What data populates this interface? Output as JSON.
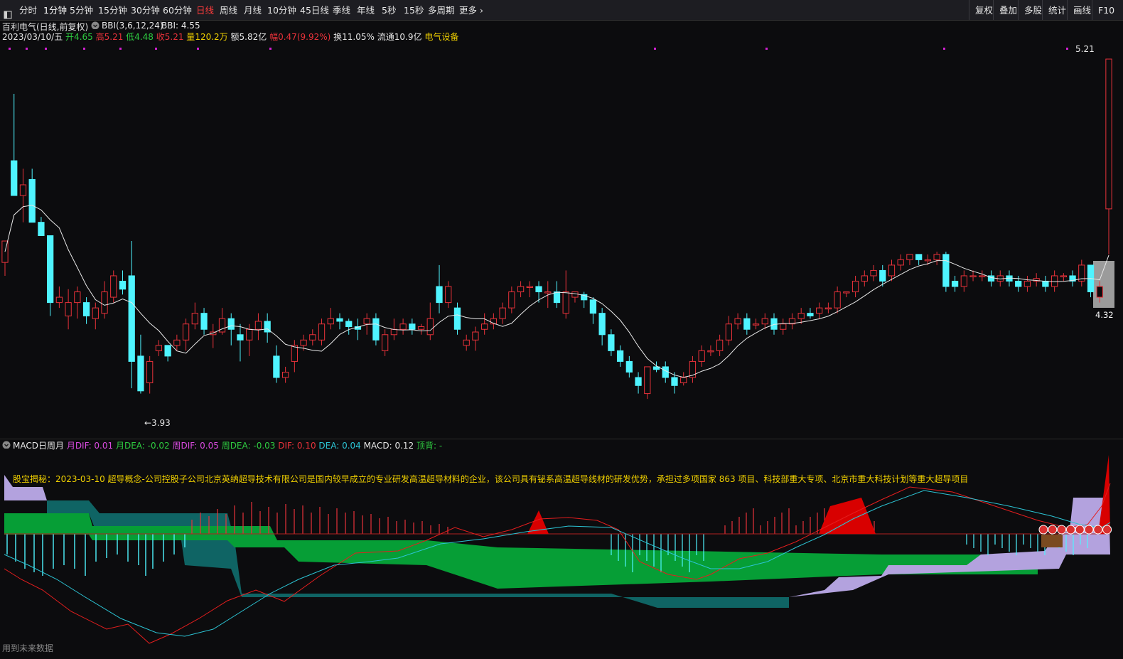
{
  "toolbar": {
    "left_icon": "layout-icon",
    "periods": [
      "分时",
      "1分钟",
      "5分钟",
      "15分钟",
      "30分钟",
      "60分钟",
      "日线",
      "周线",
      "月线",
      "10分钟",
      "45日线",
      "季线",
      "年线",
      "5秒",
      "15秒",
      "多周期",
      "更多"
    ],
    "active": "日线",
    "right": [
      "复权",
      "叠加",
      "多股",
      "统计",
      "画线",
      "F10"
    ]
  },
  "header": {
    "stock": "百利电气(日线,前复权)",
    "indicator": "BBI(3,6,12,24)",
    "indicator_value": "BBI: 4.55",
    "date": "2023/03/10/五",
    "open_label": "开",
    "open": "4.65",
    "high_label": "高",
    "high": "5.21",
    "low_label": "低",
    "low": "4.48",
    "close_label": "收",
    "close": "5.21",
    "vol_label": "量",
    "vol": "120.2万",
    "amt_label": "额",
    "amt": "5.82亿",
    "chg_label": "幅",
    "chg": "0.47(9.92%)",
    "turn_label": "换",
    "turn": "11.05%",
    "float_label": "流通",
    "float": "10.9亿",
    "sector": "电气设备"
  },
  "annotations": {
    "high_mark": "5.21",
    "low_mark": "←3.93",
    "price_tag": "4.32"
  },
  "macd_header": {
    "name": "MACD日周月",
    "m_dif": "月DIF: 0.01",
    "m_dea": "月DEA: -0.02",
    "w_dif": "周DIF: 0.05",
    "w_dea": "周DEA: -0.03",
    "dif": "DIF: 0.10",
    "dea": "DEA: 0.04",
    "macd": "MACD: 0.12",
    "top": "顶背: -"
  },
  "news": "股宝揭秘：2023-03-10 超导概念-公司控股子公司北京英纳超导技术有限公司是国内较早成立的专业研发高温超导材料的企业，该公司具有铋系高温超导线材的研发优势，承担过多项国家 863 项目、科技部重大专项、北京市重大科技计划等重大超导项目",
  "footer": "用到未来数据",
  "colors": {
    "up": "#e8323a",
    "down": "#4ff4ff",
    "bbi": "#e8e8e8",
    "green_band": "#069e36",
    "teal_band": "#0f6464",
    "lavender_band": "#b3a2de",
    "dif": "#e51e1e",
    "dea": "#2cc4d4",
    "accent": "#ff3b3b"
  },
  "chart_data": {
    "type": "candlestick",
    "y_range": [
      3.85,
      5.25
    ],
    "bbi_last": 4.55,
    "candles": [
      [
        4.45,
        4.53,
        4.4,
        4.53
      ],
      [
        4.83,
        4.7,
        4.78,
        5.08
      ],
      [
        4.7,
        4.74,
        4.6,
        4.8
      ],
      [
        4.76,
        4.6,
        4.6,
        4.8
      ],
      [
        4.6,
        4.55,
        4.55,
        4.62
      ],
      [
        4.55,
        4.3,
        4.25,
        4.55
      ],
      [
        4.3,
        4.32,
        4.28,
        4.36
      ],
      [
        4.25,
        4.3,
        4.2,
        4.35
      ],
      [
        4.3,
        4.34,
        4.24,
        4.36
      ],
      [
        4.3,
        4.25,
        4.22,
        4.32
      ],
      [
        4.24,
        4.28,
        4.2,
        4.3
      ],
      [
        4.26,
        4.34,
        4.24,
        4.38
      ],
      [
        4.32,
        4.4,
        4.3,
        4.42
      ],
      [
        4.38,
        4.35,
        4.33,
        4.42
      ],
      [
        4.4,
        4.08,
        3.98,
        4.53
      ],
      [
        4.1,
        3.97,
        3.96,
        4.18
      ],
      [
        4.0,
        4.08,
        3.96,
        4.1
      ],
      [
        4.12,
        4.14,
        4.1,
        4.16
      ],
      [
        4.14,
        4.1,
        4.08,
        4.14
      ],
      [
        4.14,
        4.16,
        4.12,
        4.18
      ],
      [
        4.16,
        4.22,
        4.12,
        4.24
      ],
      [
        4.22,
        4.26,
        4.2,
        4.3
      ],
      [
        4.26,
        4.2,
        4.18,
        4.28
      ],
      [
        4.18,
        4.19,
        4.13,
        4.22
      ],
      [
        4.19,
        4.24,
        4.18,
        4.28
      ],
      [
        4.24,
        4.2,
        4.14,
        4.26
      ],
      [
        4.18,
        4.16,
        4.08,
        4.22
      ],
      [
        4.16,
        4.2,
        4.1,
        4.22
      ],
      [
        4.2,
        4.23,
        4.16,
        4.26
      ],
      [
        4.23,
        4.19,
        4.15,
        4.26
      ],
      [
        4.1,
        4.02,
        4.0,
        4.14
      ],
      [
        4.02,
        4.04,
        4.0,
        4.06
      ],
      [
        4.08,
        4.14,
        4.04,
        4.16
      ],
      [
        4.14,
        4.16,
        4.12,
        4.18
      ],
      [
        4.16,
        4.18,
        4.14,
        4.2
      ],
      [
        4.16,
        4.22,
        4.14,
        4.24
      ],
      [
        4.22,
        4.24,
        4.2,
        4.28
      ],
      [
        4.24,
        4.23,
        4.2,
        4.26
      ],
      [
        4.23,
        4.21,
        4.18,
        4.24
      ],
      [
        4.21,
        4.2,
        4.16,
        4.24
      ],
      [
        4.22,
        4.24,
        4.18,
        4.26
      ],
      [
        4.24,
        4.16,
        4.14,
        4.26
      ],
      [
        4.12,
        4.18,
        4.1,
        4.2
      ],
      [
        4.18,
        4.2,
        4.16,
        4.24
      ],
      [
        4.2,
        4.22,
        4.18,
        4.24
      ],
      [
        4.22,
        4.2,
        4.18,
        4.24
      ],
      [
        4.2,
        4.21,
        4.18,
        4.22
      ],
      [
        4.18,
        4.24,
        4.16,
        4.3
      ],
      [
        4.36,
        4.3,
        4.26,
        4.44
      ],
      [
        4.3,
        4.36,
        4.28,
        4.38
      ],
      [
        4.28,
        4.2,
        4.18,
        4.3
      ],
      [
        4.14,
        4.16,
        4.12,
        4.18
      ],
      [
        4.16,
        4.19,
        4.12,
        4.21
      ],
      [
        4.2,
        4.22,
        4.18,
        4.26
      ],
      [
        4.22,
        4.24,
        4.2,
        4.26
      ],
      [
        4.24,
        4.28,
        4.22,
        4.3
      ],
      [
        4.28,
        4.34,
        4.26,
        4.36
      ],
      [
        4.34,
        4.36,
        4.32,
        4.38
      ],
      [
        4.36,
        4.36,
        4.32,
        4.38
      ],
      [
        4.36,
        4.34,
        4.3,
        4.38
      ],
      [
        4.34,
        4.34,
        4.28,
        4.38
      ],
      [
        4.34,
        4.3,
        4.28,
        4.38
      ],
      [
        4.26,
        4.34,
        4.24,
        4.42
      ],
      [
        4.32,
        4.34,
        4.3,
        4.34
      ],
      [
        4.33,
        4.31,
        4.28,
        4.34
      ],
      [
        4.31,
        4.26,
        4.22,
        4.32
      ],
      [
        4.26,
        4.18,
        4.14,
        4.28
      ],
      [
        4.18,
        4.12,
        4.1,
        4.2
      ],
      [
        4.12,
        4.08,
        4.06,
        4.14
      ],
      [
        4.08,
        4.04,
        4.02,
        4.1
      ],
      [
        4.02,
        3.99,
        3.96,
        4.04
      ],
      [
        3.96,
        4.06,
        3.94,
        4.06
      ],
      [
        4.06,
        4.05,
        4.04,
        4.08
      ],
      [
        4.06,
        4.02,
        4.0,
        4.08
      ],
      [
        4.02,
        3.99,
        3.96,
        4.04
      ],
      [
        4.0,
        4.02,
        3.99,
        4.04
      ],
      [
        4.02,
        4.08,
        4.0,
        4.1
      ],
      [
        4.08,
        4.12,
        4.06,
        4.14
      ],
      [
        4.12,
        4.12,
        4.1,
        4.14
      ],
      [
        4.12,
        4.16,
        4.1,
        4.18
      ],
      [
        4.16,
        4.22,
        4.14,
        4.25
      ],
      [
        4.22,
        4.24,
        4.2,
        4.26
      ],
      [
        4.24,
        4.2,
        4.18,
        4.26
      ],
      [
        4.22,
        4.22,
        4.2,
        4.24
      ],
      [
        4.22,
        4.24,
        4.2,
        4.26
      ],
      [
        4.24,
        4.2,
        4.18,
        4.26
      ],
      [
        4.2,
        4.22,
        4.18,
        4.24
      ],
      [
        4.22,
        4.24,
        4.2,
        4.26
      ],
      [
        4.24,
        4.26,
        4.22,
        4.28
      ],
      [
        4.26,
        4.25,
        4.24,
        4.28
      ],
      [
        4.26,
        4.28,
        4.24,
        4.3
      ],
      [
        4.28,
        4.28,
        4.26,
        4.3
      ],
      [
        4.28,
        4.34,
        4.26,
        4.36
      ],
      [
        4.34,
        4.34,
        4.32,
        4.34
      ],
      [
        4.34,
        4.38,
        4.32,
        4.4
      ],
      [
        4.38,
        4.4,
        4.36,
        4.42
      ],
      [
        4.4,
        4.42,
        4.38,
        4.44
      ],
      [
        4.42,
        4.38,
        4.36,
        4.44
      ],
      [
        4.4,
        4.44,
        4.38,
        4.46
      ],
      [
        4.44,
        4.46,
        4.42,
        4.48
      ],
      [
        4.46,
        4.48,
        4.44,
        4.48
      ],
      [
        4.48,
        4.46,
        4.44,
        4.48
      ],
      [
        4.46,
        4.46,
        4.44,
        4.48
      ],
      [
        4.46,
        4.48,
        4.44,
        4.49
      ],
      [
        4.48,
        4.36,
        4.34,
        4.49
      ],
      [
        4.38,
        4.36,
        4.34,
        4.4
      ],
      [
        4.36,
        4.4,
        4.34,
        4.42
      ],
      [
        4.4,
        4.4,
        4.38,
        4.42
      ],
      [
        4.4,
        4.4,
        4.38,
        4.42
      ],
      [
        4.4,
        4.38,
        4.36,
        4.42
      ],
      [
        4.38,
        4.4,
        4.36,
        4.42
      ],
      [
        4.4,
        4.38,
        4.36,
        4.42
      ],
      [
        4.38,
        4.36,
        4.34,
        4.4
      ],
      [
        4.36,
        4.38,
        4.34,
        4.4
      ],
      [
        4.38,
        4.39,
        4.36,
        4.41
      ],
      [
        4.38,
        4.36,
        4.34,
        4.4
      ],
      [
        4.36,
        4.4,
        4.34,
        4.42
      ],
      [
        4.4,
        4.4,
        4.38,
        4.41
      ],
      [
        4.4,
        4.38,
        4.36,
        4.42
      ],
      [
        4.38,
        4.44,
        4.36,
        4.46
      ],
      [
        4.44,
        4.34,
        4.32,
        4.44
      ],
      [
        4.32,
        4.36,
        4.3,
        4.38
      ],
      [
        4.65,
        5.21,
        4.48,
        5.21
      ]
    ]
  }
}
